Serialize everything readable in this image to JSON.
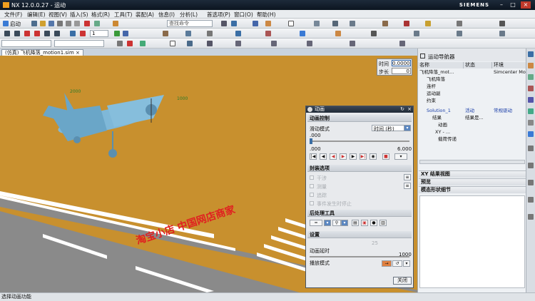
{
  "window": {
    "title": "NX 12.0.0.27 - 运动",
    "brand": "SIEMENS"
  },
  "menu": [
    "文件(F)",
    "编辑(E)",
    "视图(V)",
    "插入(S)",
    "格式(R)",
    "工具(T)",
    "装配(A)",
    "信息(I)",
    "分析(L)",
    "首选项(P)",
    "窗口(O)",
    "帮助(H)"
  ],
  "toolbar": {
    "start_label": "启动",
    "search_placeholder": "查找命令",
    "layer_value": "1"
  },
  "tab": {
    "label": "(仿真) 飞机降落_motion1.sim"
  },
  "time_box": {
    "time_label": "时间",
    "time_value": "0.0000",
    "step_label": "步长",
    "step_value": "0"
  },
  "animation_dialog": {
    "title": "动画",
    "control_section": "动画控制",
    "slide_mode_label": "滑动模式",
    "slide_mode_value": "时间 (秒)",
    "slider_value": ".000",
    "range_start": ".000",
    "range_end": "6.000",
    "package_section": "封装选项",
    "package_options": [
      "干涉",
      "测量",
      "追踪",
      "事件发生时停止"
    ],
    "post_section": "后处理工具",
    "settings_section": "设置",
    "delay_label": "动画延时",
    "delay_value": "25",
    "delay_max": "1000",
    "play_mode_label": "播放模式",
    "close_button": "关闭"
  },
  "navigator": {
    "title": "运动导航器",
    "columns": [
      "名称",
      "状态",
      "环境"
    ],
    "rows": [
      {
        "name": "飞机降落_mot...",
        "status": "",
        "env": "Simcenter Mot"
      },
      {
        "name": "飞机降落",
        "status": "",
        "env": ""
      },
      {
        "name": "连杆",
        "status": "",
        "env": ""
      },
      {
        "name": "运动副",
        "status": "",
        "env": ""
      },
      {
        "name": "约束",
        "status": "",
        "env": ""
      },
      {
        "name": "Solution_1",
        "status": "活动",
        "env": "常规驱动"
      },
      {
        "name": "结果",
        "status": "结果是...",
        "env": ""
      },
      {
        "name": "动画",
        "status": "",
        "env": ""
      },
      {
        "name": "XY - ...",
        "status": "",
        "env": ""
      },
      {
        "name": "载荷传递",
        "status": "",
        "env": ""
      }
    ],
    "panels": [
      "XY 结果视图",
      "预览",
      "模态形状细节"
    ]
  },
  "viewport": {
    "marker1": "2000",
    "marker2": "1000"
  },
  "watermark": "淘宝小店  中国网店商家",
  "status_bar": "选择动画功能",
  "colors": {
    "ground": "#c8902e",
    "plane": "#7fb8d8",
    "runway": "#8a8a8a",
    "accent": "#0b5fa5"
  }
}
